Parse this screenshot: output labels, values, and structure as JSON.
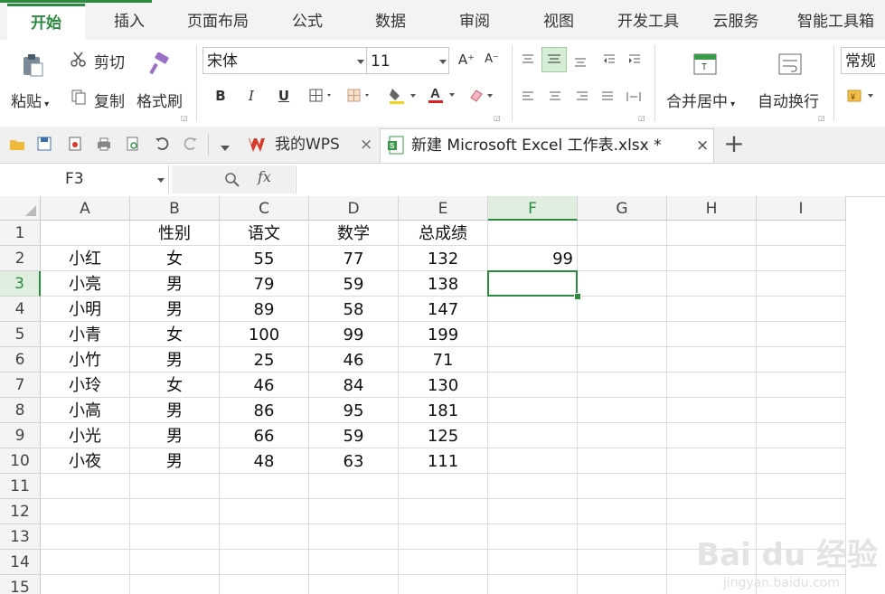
{
  "menu_tabs": [
    "开始",
    "插入",
    "页面布局",
    "公式",
    "数据",
    "审阅",
    "视图",
    "开发工具",
    "云服务",
    "智能工具箱"
  ],
  "ribbon": {
    "paste": "粘贴",
    "cut": "剪切",
    "copy": "复制",
    "format_painter": "格式刷",
    "font_name": "宋体",
    "font_size": "11",
    "grow_font": "A⁺",
    "shrink_font": "A⁻",
    "bold": "B",
    "italic": "I",
    "underline": "U",
    "merge_center": "合并居中",
    "wrap_text": "自动换行",
    "number_format": "常规"
  },
  "doc_tabs": [
    {
      "label": "我的WPS",
      "close": "×"
    },
    {
      "label": "新建 Microsoft Excel 工作表.xlsx *",
      "close": "×"
    }
  ],
  "add_tab": "+",
  "formula_bar": {
    "name_box": "F3",
    "fx": "fx",
    "formula": ""
  },
  "columns": [
    "A",
    "B",
    "C",
    "D",
    "E",
    "F",
    "G",
    "H",
    "I"
  ],
  "rows": [
    "1",
    "2",
    "3",
    "4",
    "5",
    "6",
    "7",
    "8",
    "9",
    "10",
    "11",
    "12",
    "13",
    "14",
    "15"
  ],
  "selected_cell": "F3",
  "table": [
    [
      "",
      "性别",
      "语文",
      "数学",
      "总成绩",
      ""
    ],
    [
      "小红",
      "女",
      "55",
      "77",
      "132",
      "99"
    ],
    [
      "小亮",
      "男",
      "79",
      "59",
      "138",
      ""
    ],
    [
      "小明",
      "男",
      "89",
      "58",
      "147",
      ""
    ],
    [
      "小青",
      "女",
      "100",
      "99",
      "199",
      ""
    ],
    [
      "小竹",
      "男",
      "25",
      "46",
      "71",
      ""
    ],
    [
      "小玲",
      "女",
      "46",
      "84",
      "130",
      ""
    ],
    [
      "小高",
      "男",
      "86",
      "95",
      "181",
      ""
    ],
    [
      "小光",
      "男",
      "66",
      "59",
      "125",
      ""
    ],
    [
      "小夜",
      "男",
      "48",
      "63",
      "111",
      ""
    ]
  ],
  "watermark": {
    "brand": "Bai du 经验",
    "url": "jingyan.baidu.com"
  },
  "colors": {
    "accent": "#2a8a3e",
    "wps_red": "#d83b2b"
  }
}
